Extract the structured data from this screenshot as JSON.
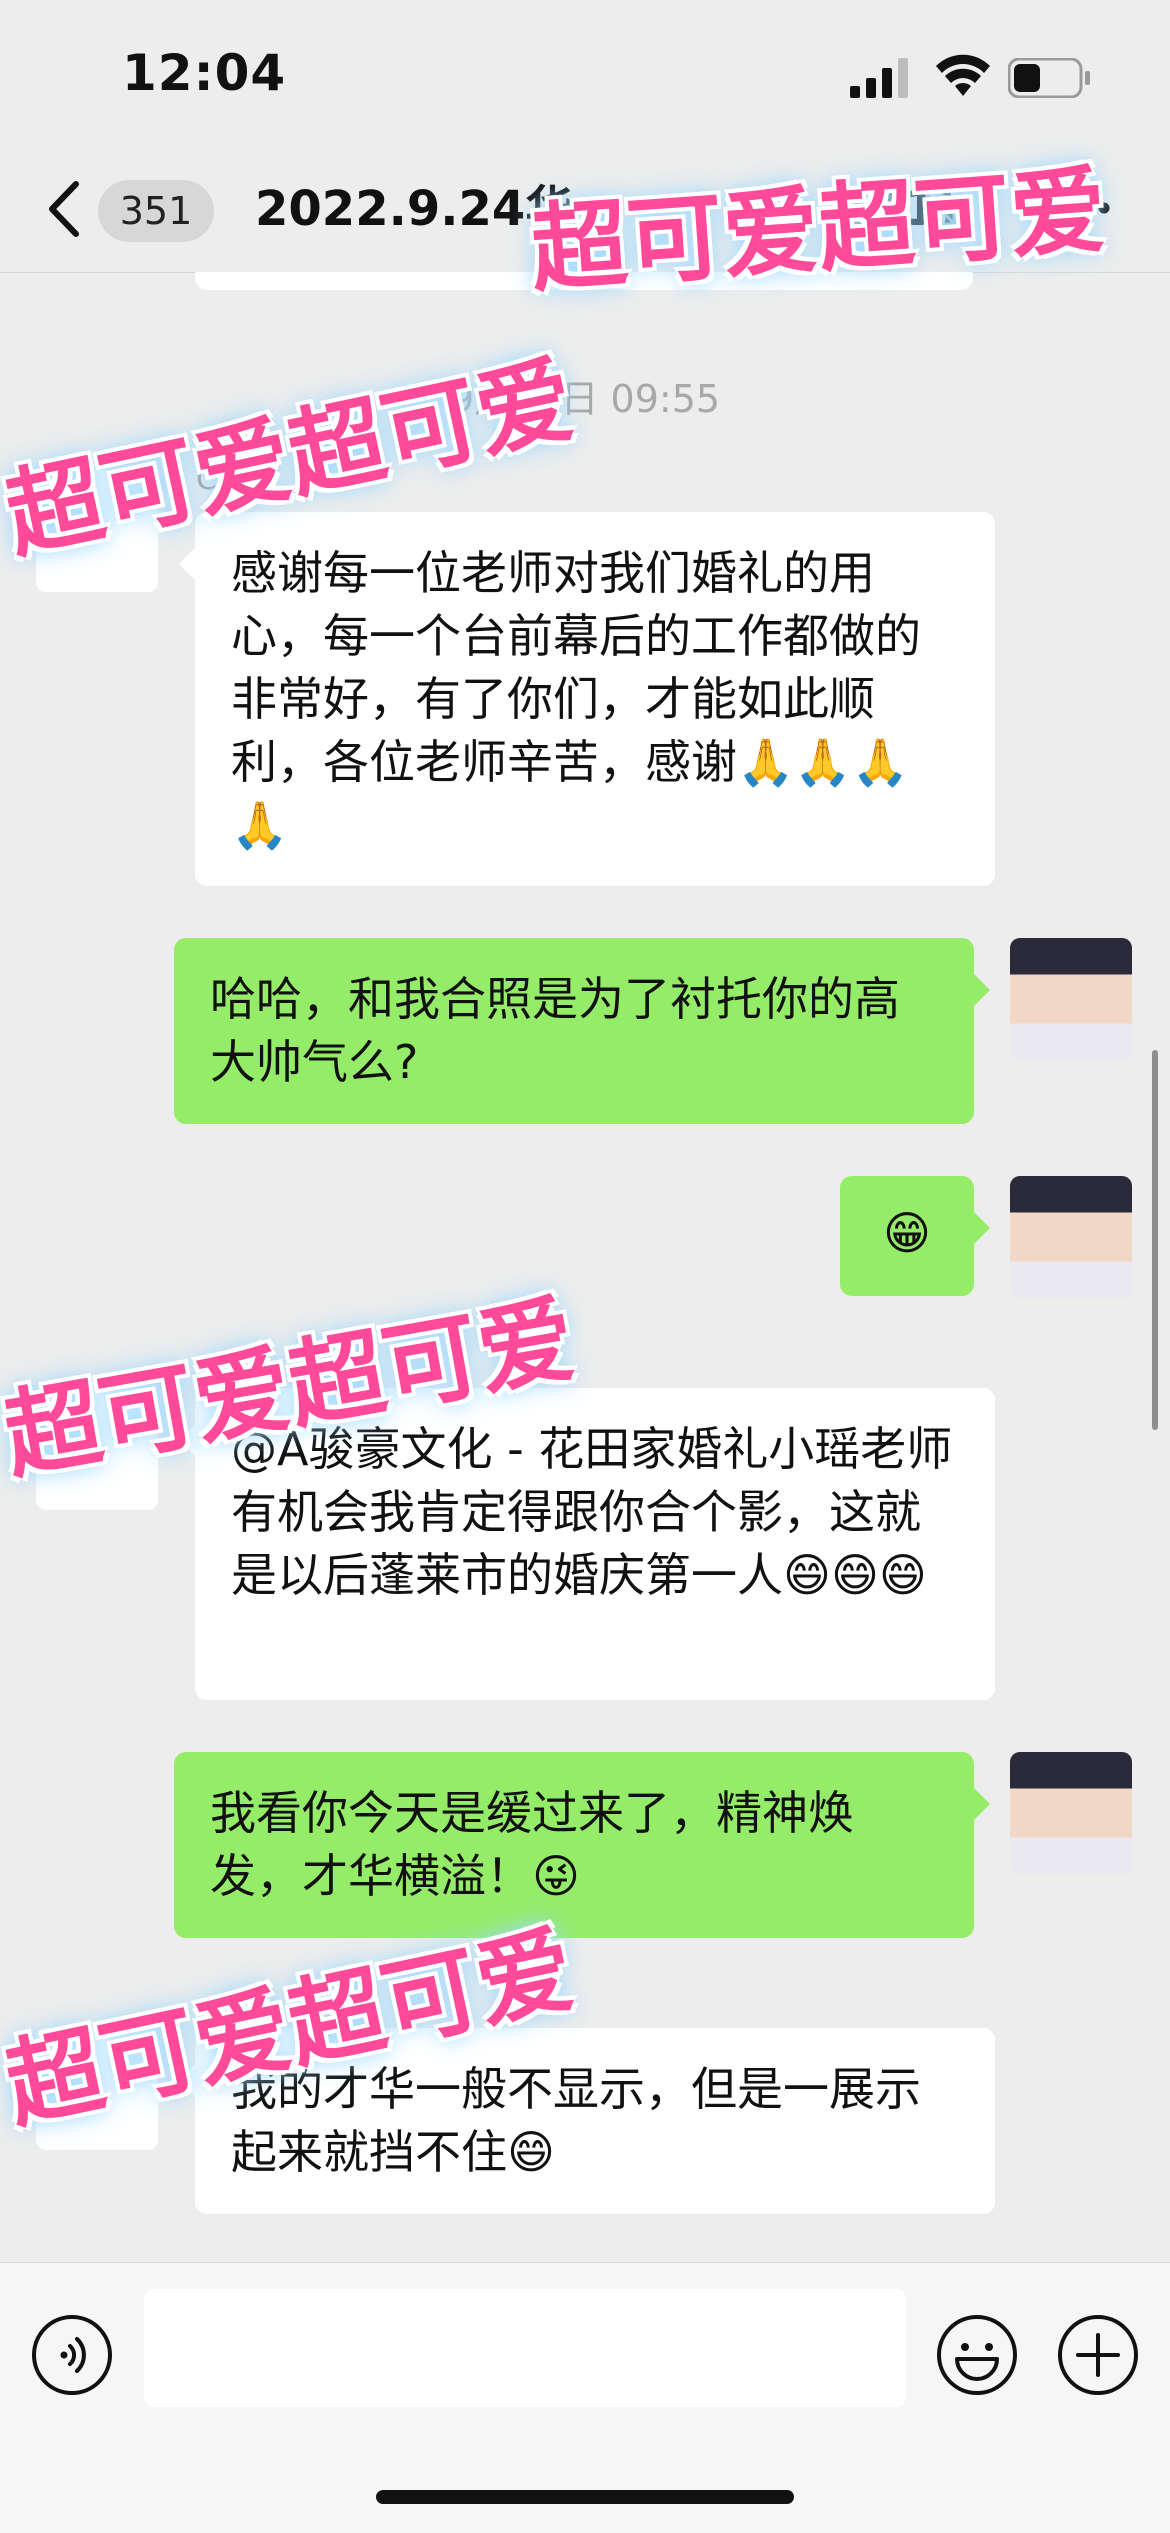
{
  "status": {
    "time": "12:04"
  },
  "nav": {
    "unread_count": "351",
    "title": "2022.9.24华",
    "member_count": "(11)"
  },
  "conversation": {
    "timestamp": "9月27日 09:55",
    "partial_sender": "CUT",
    "messages": [
      {
        "side": "in",
        "text": "感谢每一位老师对我们婚礼的用心，每一个台前幕后的工作都做的非常好，有了你们，才能如此顺利，各位老师辛苦，感谢🙏🙏🙏🙏"
      },
      {
        "side": "out",
        "text": "哈哈，和我合照是为了衬托你的高大帅气么?"
      },
      {
        "side": "out",
        "text": "😁"
      },
      {
        "side": "in",
        "text": "@A骏豪文化 - 花田家婚礼小瑶老师 有机会我肯定得跟你合个影，这就是以后蓬莱市的婚庆第一人😄😄😄"
      },
      {
        "side": "out",
        "text": "我看你今天是缓过来了，精神焕发，才华横溢！😜"
      },
      {
        "side": "in",
        "text": "我的才华一般不显示，但是一展示起来就挡不住😄"
      }
    ]
  },
  "stickers": {
    "sticker_text": "超可爱超可爱"
  },
  "input": {
    "placeholder": ""
  },
  "colors": {
    "background": "#ededed",
    "outgoing_bubble": "#95ec69",
    "incoming_bubble": "#ffffff",
    "sticker_pink": "#ff4a9a"
  }
}
